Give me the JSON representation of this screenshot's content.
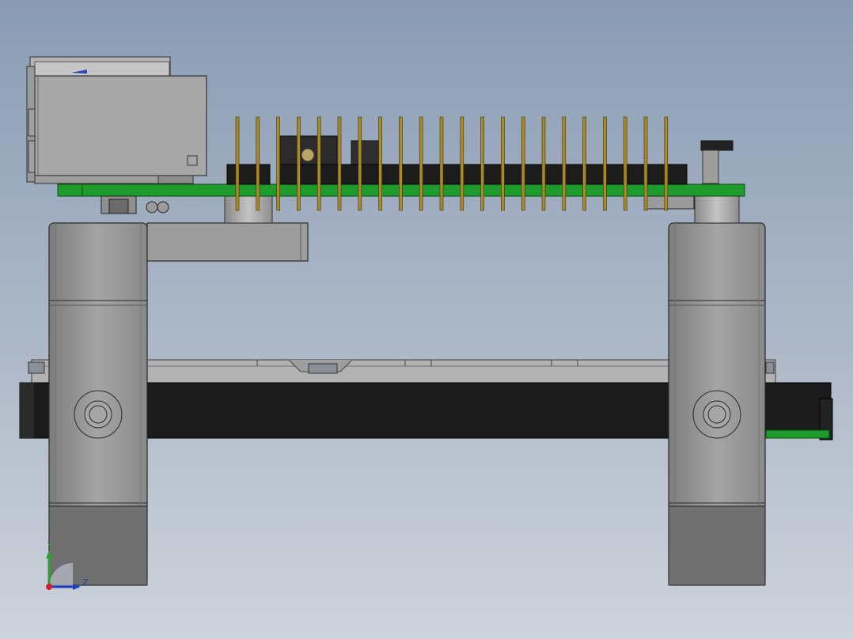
{
  "scene": {
    "view": "front",
    "background_top": "#8a9cb4",
    "background_bottom": "#cdd3dc"
  },
  "triad": {
    "y_label": "Y",
    "z_label": "Z",
    "y_color": "#2ca02c",
    "z_color": "#1f3fbf",
    "origin_color": "#d0202a"
  },
  "colors": {
    "pcb": "#1f9a2c",
    "header_body": "#1c1c1c",
    "pin": "#a88a2a",
    "metal_part": "#9b9b9b",
    "display_band": "#1a1a1a",
    "connector": "#a9aaab"
  },
  "header": {
    "pin_count": 22
  }
}
